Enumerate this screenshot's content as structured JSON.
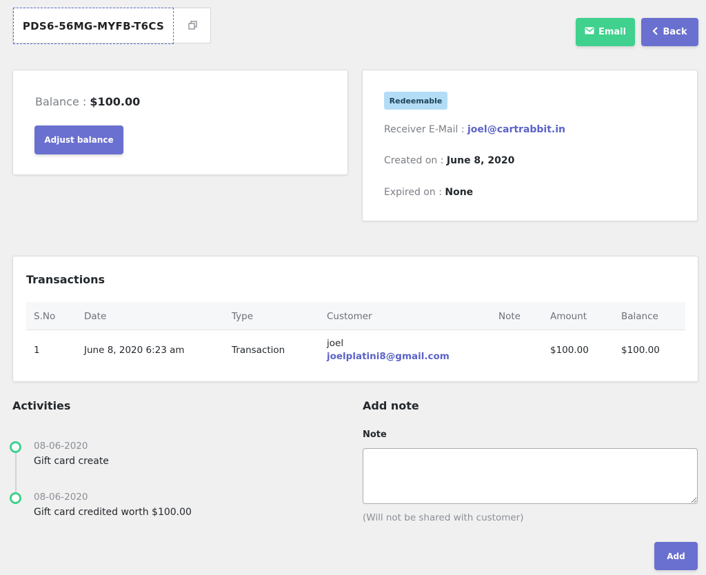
{
  "header": {
    "gift_card_code": "PDS6-56MG-MYFB-T6CS",
    "copy_icon": "copy-icon",
    "email_button": "Email",
    "back_button": "Back"
  },
  "balance_card": {
    "label": "Balance :",
    "value": "$100.00",
    "adjust_button": "Adjust balance"
  },
  "info_card": {
    "status_badge": "Redeemable",
    "receiver_label": "Receiver E-Mail :",
    "receiver_email": "joel@cartrabbit.in",
    "created_label": "Created on :",
    "created_value": "June 8, 2020",
    "expired_label": "Expired on :",
    "expired_value": "None"
  },
  "transactions": {
    "title": "Transactions",
    "columns": [
      "S.No",
      "Date",
      "Type",
      "Customer",
      "Note",
      "Amount",
      "Balance"
    ],
    "rows": [
      {
        "sno": "1",
        "date": "June 8, 2020 6:23 am",
        "type": "Transaction",
        "customer_name": "joel",
        "customer_email": "joelplatini8@gmail.com",
        "note": "",
        "amount": "$100.00",
        "balance": "$100.00"
      }
    ]
  },
  "activities": {
    "title": "Activities",
    "items": [
      {
        "date": "08-06-2020",
        "text": "Gift card create"
      },
      {
        "date": "08-06-2020",
        "text": "Gift card credited worth $100.00"
      }
    ]
  },
  "add_note": {
    "title": "Add note",
    "label": "Note",
    "value": "",
    "hint": "(Will not be shared with customer)",
    "add_button": "Add"
  },
  "colors": {
    "primary": "#6a70cf",
    "success": "#3fd18d",
    "badge_bg": "#b3ddf6",
    "link": "#5b63c8"
  }
}
